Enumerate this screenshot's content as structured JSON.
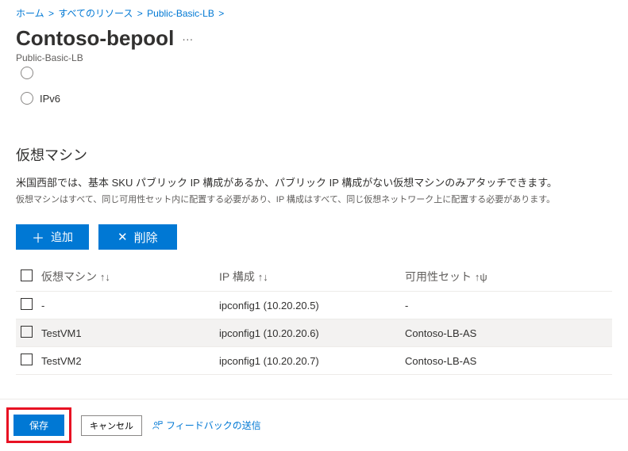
{
  "breadcrumb": {
    "home": "ホーム",
    "resources": "すべてのリソース",
    "parent": "Public-Basic-LB"
  },
  "title": "Contoso-bepool",
  "subtitle": "Public-Basic-LB",
  "ipv_option_placeholder": ". . . .",
  "ipv6_label": "IPv6",
  "section_title": "仮想マシン",
  "desc1": "米国西部では、基本 SKU パブリック IP 構成があるか、パブリック IP 構成がない仮想マシンのみアタッチできます。",
  "desc2": "仮想マシンはすべて、同じ可用性セット内に配置する必要があり、IP 構成はすべて、同じ仮想ネットワーク上に配置する必要があります。",
  "toolbar": {
    "add_label": "追加",
    "delete_label": "削除"
  },
  "columns": {
    "vm": "仮想マシン",
    "vm_sort": "↑↓",
    "ip": "IP 構成",
    "ip_sort": "↑↓",
    "avset": "可用性セット",
    "avset_sort": "↑ψ"
  },
  "rows": [
    {
      "vm": "-",
      "ip": "ipconfig1 (10.20.20.5)",
      "avset": "-"
    },
    {
      "vm": "TestVM1",
      "ip": "ipconfig1 (10.20.20.6)",
      "avset": "Contoso-LB-AS"
    },
    {
      "vm": "TestVM2",
      "ip": "ipconfig1 (10.20.20.7)",
      "avset": "Contoso-LB-AS"
    }
  ],
  "footer": {
    "save": "保存",
    "cancel": "キャンセル",
    "feedback": "フィードバックの送信"
  }
}
